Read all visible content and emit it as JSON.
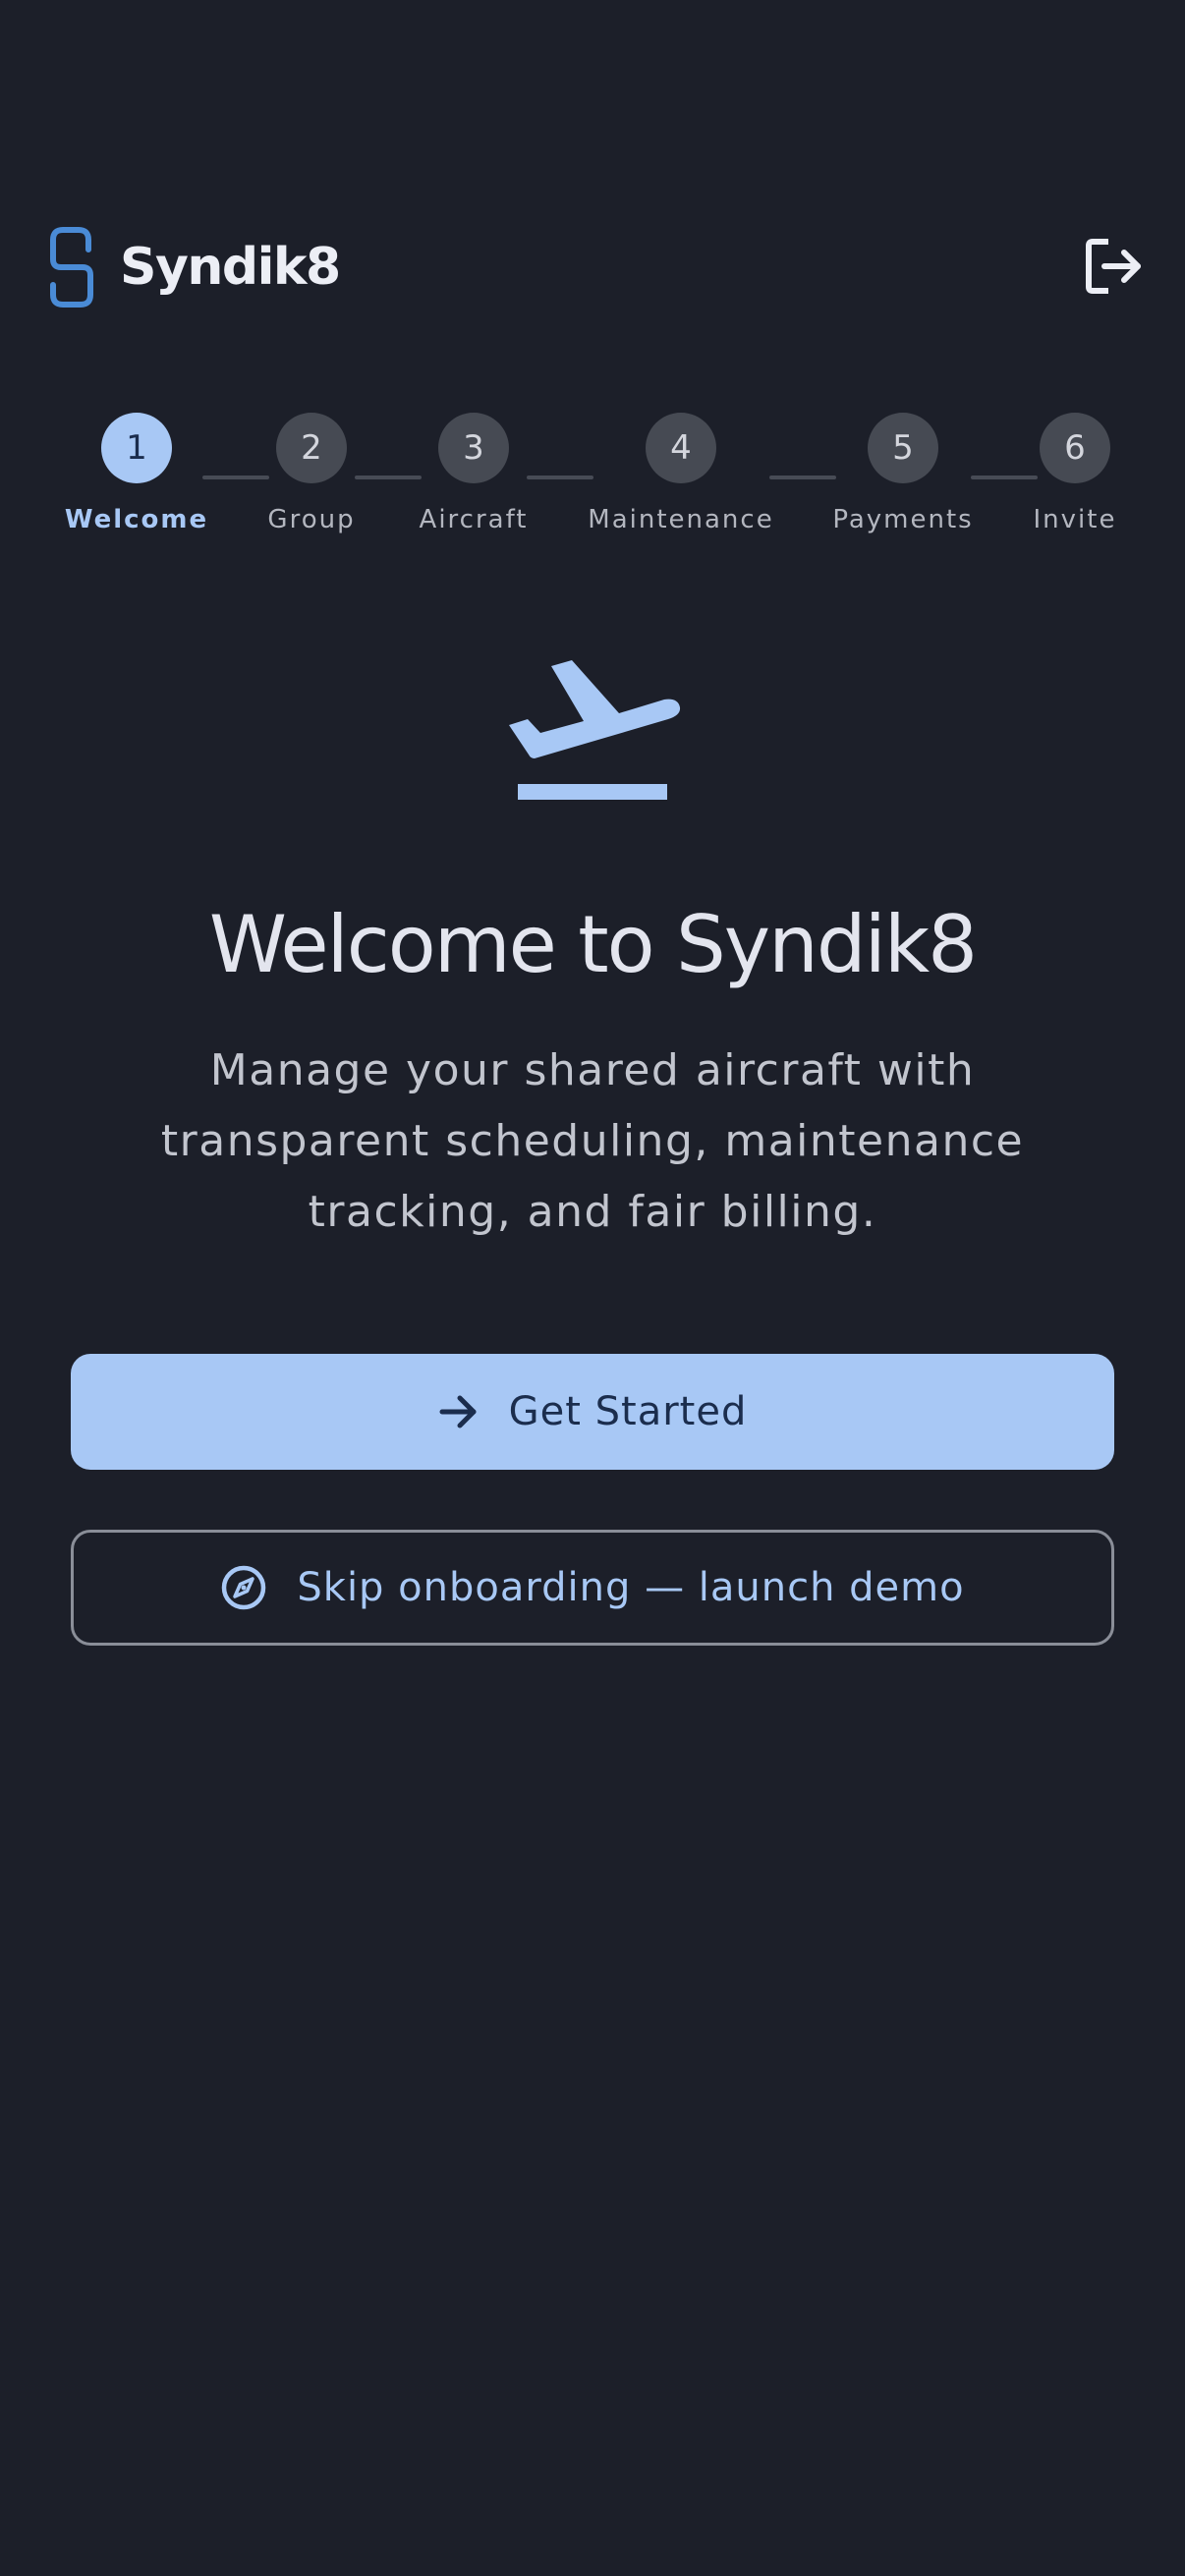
{
  "app": {
    "name": "Syndik8"
  },
  "header": {
    "logout_icon": "logout-icon"
  },
  "stepper": {
    "steps": [
      {
        "number": "1",
        "label": "Welcome",
        "active": true
      },
      {
        "number": "2",
        "label": "Group",
        "active": false
      },
      {
        "number": "3",
        "label": "Aircraft",
        "active": false
      },
      {
        "number": "4",
        "label": "Maintenance",
        "active": false
      },
      {
        "number": "5",
        "label": "Payments",
        "active": false
      },
      {
        "number": "6",
        "label": "Invite",
        "active": false
      }
    ]
  },
  "hero": {
    "icon": "flight-takeoff-icon",
    "title": "Welcome to Syndik8",
    "subtitle": "Manage your shared aircraft with transparent scheduling, maintenance tracking, and fair billing."
  },
  "actions": {
    "primary_label": "Get Started",
    "primary_icon": "arrow-right-icon",
    "secondary_label": "Skip onboarding — launch demo",
    "secondary_icon": "compass-icon"
  },
  "colors": {
    "background": "#1c1f29",
    "accent": "#a8c8f5",
    "accent_on": "#1b2d4d",
    "inactive_step": "#464a53",
    "logo": "#4a8bd6"
  }
}
